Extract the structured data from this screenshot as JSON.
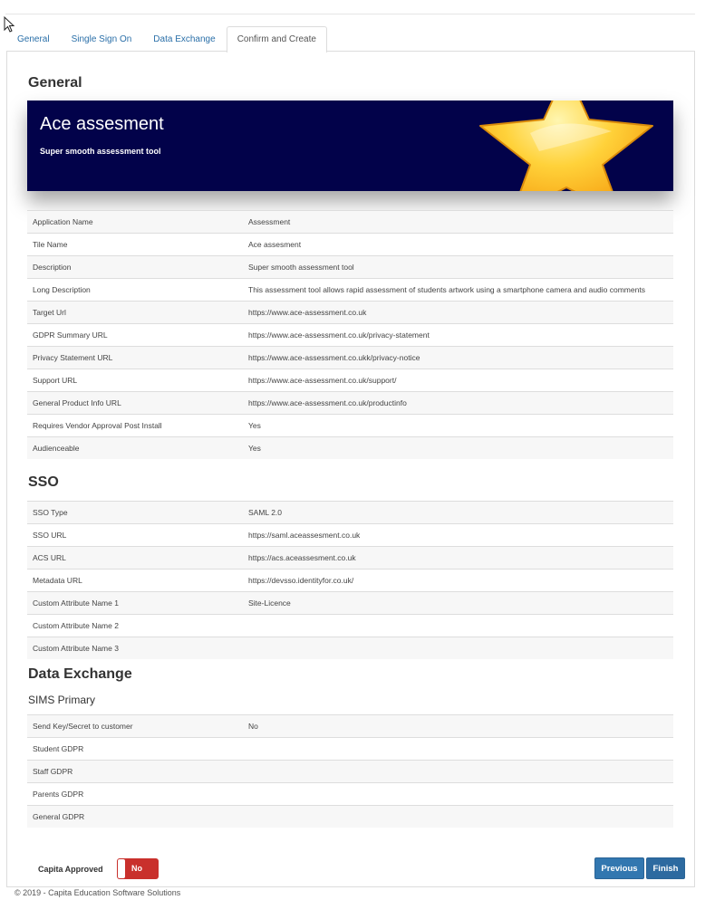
{
  "tabs": [
    {
      "label": "General",
      "active": false
    },
    {
      "label": "Single Sign On",
      "active": false
    },
    {
      "label": "Data Exchange",
      "active": false
    },
    {
      "label": "Confirm and Create",
      "active": true
    }
  ],
  "general": {
    "heading": "General",
    "banner": {
      "title": "Ace assesment",
      "subtitle": "Super smooth assessment tool",
      "background": "#02024a",
      "image": "star-icon"
    },
    "rows": [
      {
        "key": "Application Name",
        "value": "Assessment"
      },
      {
        "key": "Tile Name",
        "value": "Ace assesment"
      },
      {
        "key": "Description",
        "value": "Super smooth assessment tool"
      },
      {
        "key": "Long Description",
        "value": "This assessment tool allows rapid assessment of students artwork using a smartphone camera and audio comments"
      },
      {
        "key": "Target Url",
        "value": "https://www.ace-assessment.co.uk"
      },
      {
        "key": "GDPR Summary URL",
        "value": "https://www.ace-assessment.co.uk/privacy-statement"
      },
      {
        "key": "Privacy Statement URL",
        "value": "https://www.ace-assessment.co.ukk/privacy-notice"
      },
      {
        "key": "Support URL",
        "value": "https://www.ace-assessment.co.uk/support/"
      },
      {
        "key": "General Product Info URL",
        "value": "https://www.ace-assessment.co.uk/productinfo"
      },
      {
        "key": "Requires Vendor Approval Post Install",
        "value": "Yes"
      },
      {
        "key": "Audienceable",
        "value": "Yes"
      }
    ]
  },
  "sso": {
    "heading": "SSO",
    "rows": [
      {
        "key": "SSO Type",
        "value": "SAML 2.0"
      },
      {
        "key": "SSO URL",
        "value": "https://saml.aceassesment.co.uk"
      },
      {
        "key": "ACS URL",
        "value": "https://acs.aceassesment.co.uk"
      },
      {
        "key": "Metadata URL",
        "value": "https://devsso.identityfor.co.uk/"
      },
      {
        "key": "Custom Attribute Name 1",
        "value": "Site-Licence"
      },
      {
        "key": "Custom Attribute Name 2",
        "value": ""
      },
      {
        "key": "Custom Attribute Name 3",
        "value": ""
      }
    ]
  },
  "data_exchange": {
    "heading": "Data Exchange",
    "subheading": "SIMS Primary",
    "rows": [
      {
        "key": "Send Key/Secret to customer",
        "value": "No"
      },
      {
        "key": "Student GDPR",
        "value": ""
      },
      {
        "key": "Staff GDPR",
        "value": ""
      },
      {
        "key": "Parents GDPR",
        "value": ""
      },
      {
        "key": "General GDPR",
        "value": ""
      }
    ]
  },
  "footer": {
    "approved_label": "Capita Approved",
    "approved_toggle": "No",
    "toggle_color": "#c9302c",
    "previous_label": "Previous",
    "finish_label": "Finish",
    "button_color": "#3277b0",
    "copyright": "© 2019 - Capita Education Software Solutions"
  }
}
